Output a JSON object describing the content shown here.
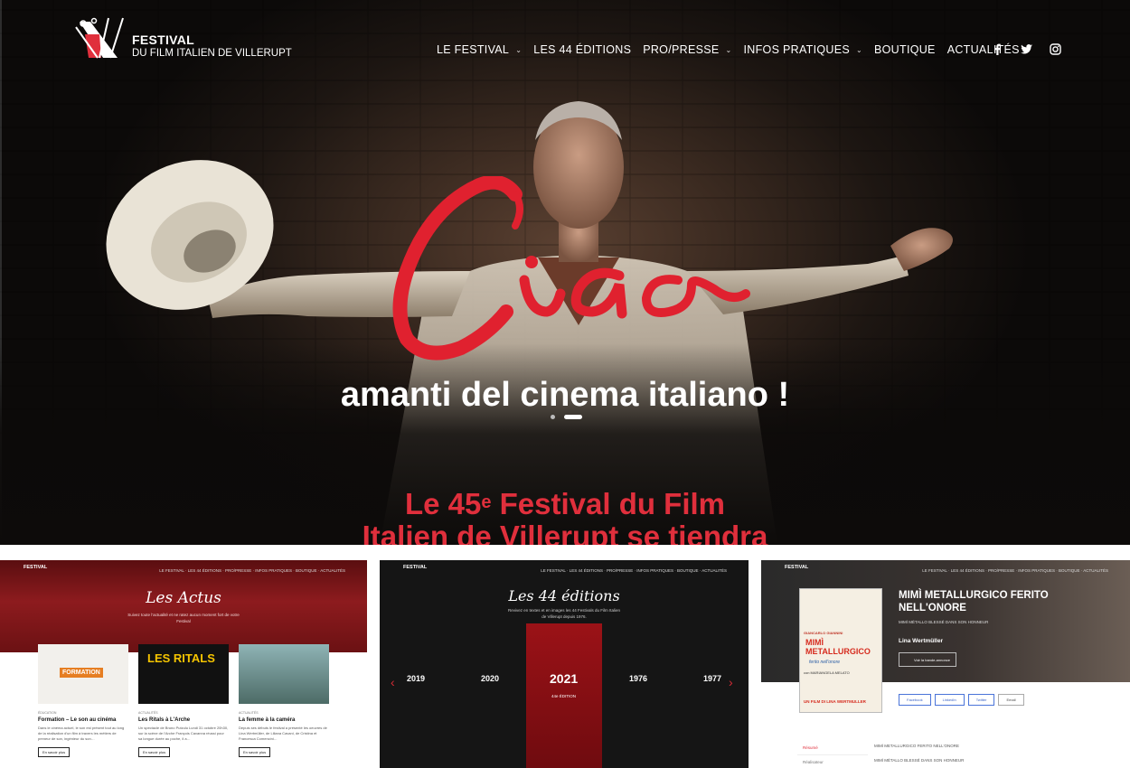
{
  "brand": {
    "title": "FESTIVAL",
    "subtitle": "DU FILM ITALIEN DE VILLERUPT"
  },
  "nav": {
    "items": [
      {
        "label": "LE FESTIVAL",
        "has_dropdown": true
      },
      {
        "label": "LES 44 ÉDITIONS",
        "has_dropdown": false
      },
      {
        "label": "PRO/PRESSE",
        "has_dropdown": true
      },
      {
        "label": "INFOS PRATIQUES",
        "has_dropdown": true
      },
      {
        "label": "BOUTIQUE",
        "has_dropdown": false
      },
      {
        "label": "ACTUALITÉS",
        "has_dropdown": false
      }
    ],
    "social": [
      "facebook-icon",
      "twitter-icon",
      "instagram-icon"
    ]
  },
  "hero": {
    "script_word": "Ciao",
    "tagline": "amanti del cinema italiano !",
    "slides": 2,
    "active_slide": 2
  },
  "headline": {
    "line1_prefix": "Le 45",
    "line1_sup": "e",
    "line1_suffix": " Festival du Film",
    "line2": "Italien de Villerupt se tiendra"
  },
  "colors": {
    "accent": "#e02f3c",
    "hero_dark": "#0d0b0a"
  },
  "thumbs": {
    "actus": {
      "title": "Les Actus",
      "subtitle": "Suivez toute l'actualité et ne ratez aucun moment fort de votre Festival",
      "cards": [
        {
          "cat": "ÉDUCATION",
          "title": "Formation – Le son au cinéma",
          "text": "Dans le cinéma actuel, le son est présent tout au long de la réalisation d'un film à travers les métiers de preneur de son, ingénieur du son…",
          "btn": "En savoir plus",
          "poster": "FORMATION"
        },
        {
          "cat": "ACTUALITÉS",
          "title": "Les Ritals à L'Arche",
          "text": "Un spectacle de Bruno Putzulu Lundi 31 octobre 20h30, sur la scène de l'Arche François Cavanna réussi pour sa longue durée au poche, il a…",
          "btn": "En savoir plus",
          "poster": "LES RITALS"
        },
        {
          "cat": "ACTUALITÉS",
          "title": "La femme à la caméra",
          "text": "Depuis ses débuts le festival a présenté les oeuvres de Lina Wertmüller, de Liliana Cavani, de Cristina et Francesca Comencini…",
          "btn": "En savoir plus",
          "poster": ""
        }
      ]
    },
    "editions": {
      "title": "Les 44 éditions",
      "subtitle": "Revivez en textes et en images les 44 Festivals du Film Italien de Villerupt depuis 1976.",
      "years": [
        "2019",
        "2020",
        "2021",
        "1976",
        "1977"
      ],
      "current_edition": "44e ÉDITION"
    },
    "film": {
      "title": "MIMÌ METALLURGICO FERITO NELL'ONORE",
      "subtitle": "MIMÌ MÉTALLO BLESSÉ DANS SON HONNEUR",
      "director": "Lina Wertmüller",
      "trailer": "Voir la bande-annonce",
      "share": [
        "Facebook",
        "LinkedIn",
        "Twitter",
        "Email"
      ],
      "tabs": [
        "Résumé",
        "Réalisateur"
      ],
      "info_lines": [
        "MIMÌ METALLURGICO FERITO NELL'ONORE",
        "MIMÌ MÉTALLO BLESSÉ DANS SON HONNEUR"
      ],
      "poster": {
        "top": "GIANCARLO GIANNINI",
        "title": "MIMÌ METALLURGICO",
        "line": "ferito nell'onore",
        "cast": "con MARIANGELA MELATO",
        "credit": "UN FILM DI LINA WERTMULLER"
      }
    }
  }
}
